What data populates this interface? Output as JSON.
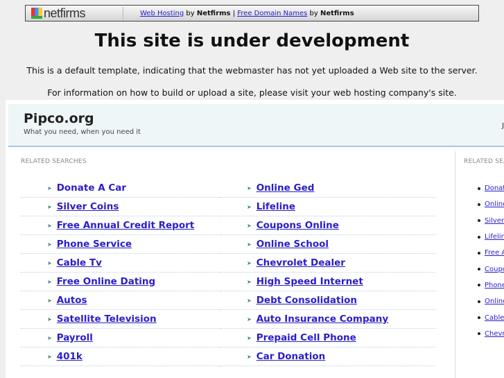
{
  "banner": {
    "logo": "netfirms",
    "link1": "Web Hosting",
    "by1": "by",
    "brand1": "Netfirms",
    "divider": "|",
    "link2": "Free Domain Names",
    "by2": "by",
    "brand2": "Netfirms"
  },
  "title": "This site is under development",
  "message1": "This is a default template, indicating that the webmaster has not yet uploaded a Web site to the server.",
  "message2": "For information on how to build or upload a site, please visit your web hosting company's site.",
  "site": {
    "name": "Pipco.org",
    "tagline": "What you need, when you need it",
    "date": "Ju"
  },
  "related_label": "RELATED SEARCHES",
  "left_col1": [
    "Donate A Car",
    "Silver Coins",
    "Free Annual Credit Report",
    "Phone Service",
    "Cable Tv",
    "Free Online Dating",
    "Autos",
    "Satellite Television",
    "Payroll",
    "401k"
  ],
  "left_col2": [
    "Online Ged",
    "Lifeline",
    "Coupons Online",
    "Online School",
    "Chevrolet Dealer",
    "High Speed Internet",
    "Debt Consolidation",
    "Auto Insurance Company",
    "Prepaid Cell Phone",
    "Car Donation"
  ],
  "right_list": [
    "Donate A Car",
    "Online Ged",
    "Silver Coins",
    "Lifeline",
    "Free Annual Credit Report",
    "Coupons Online",
    "Phone Service",
    "Online School",
    "Cable Tv",
    "Chevrolet Dealer"
  ]
}
